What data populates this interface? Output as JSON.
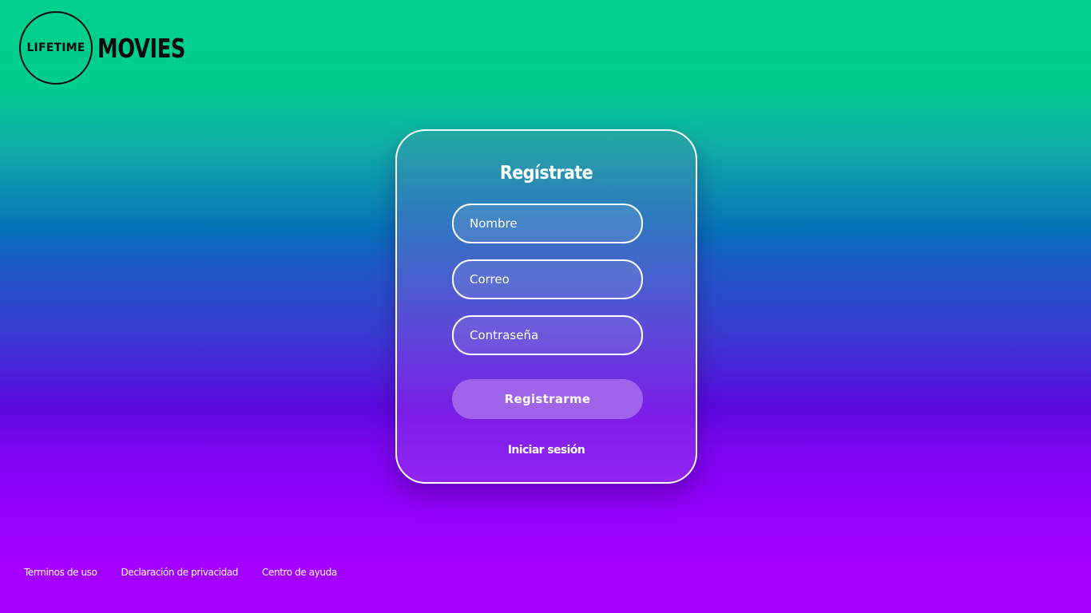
{
  "brand": {
    "circle_text": "LIFETIME",
    "word": "MOVIES"
  },
  "form": {
    "title": "Regístrate",
    "name_placeholder": "Nombre",
    "email_placeholder": "Correo",
    "password_placeholder": "Contraseña",
    "submit_label": "Registrarme",
    "login_link": "Iniciar sesión"
  },
  "footer": {
    "links": [
      "Terminos de uso",
      "Declaración de privacidad",
      "Centro de ayuda"
    ]
  },
  "colors": {
    "top_background": "#00d08c",
    "middle_background": "#0670b8",
    "bottom_background": "#a700ff",
    "button": "#a064ea",
    "text": "#ffffff"
  }
}
